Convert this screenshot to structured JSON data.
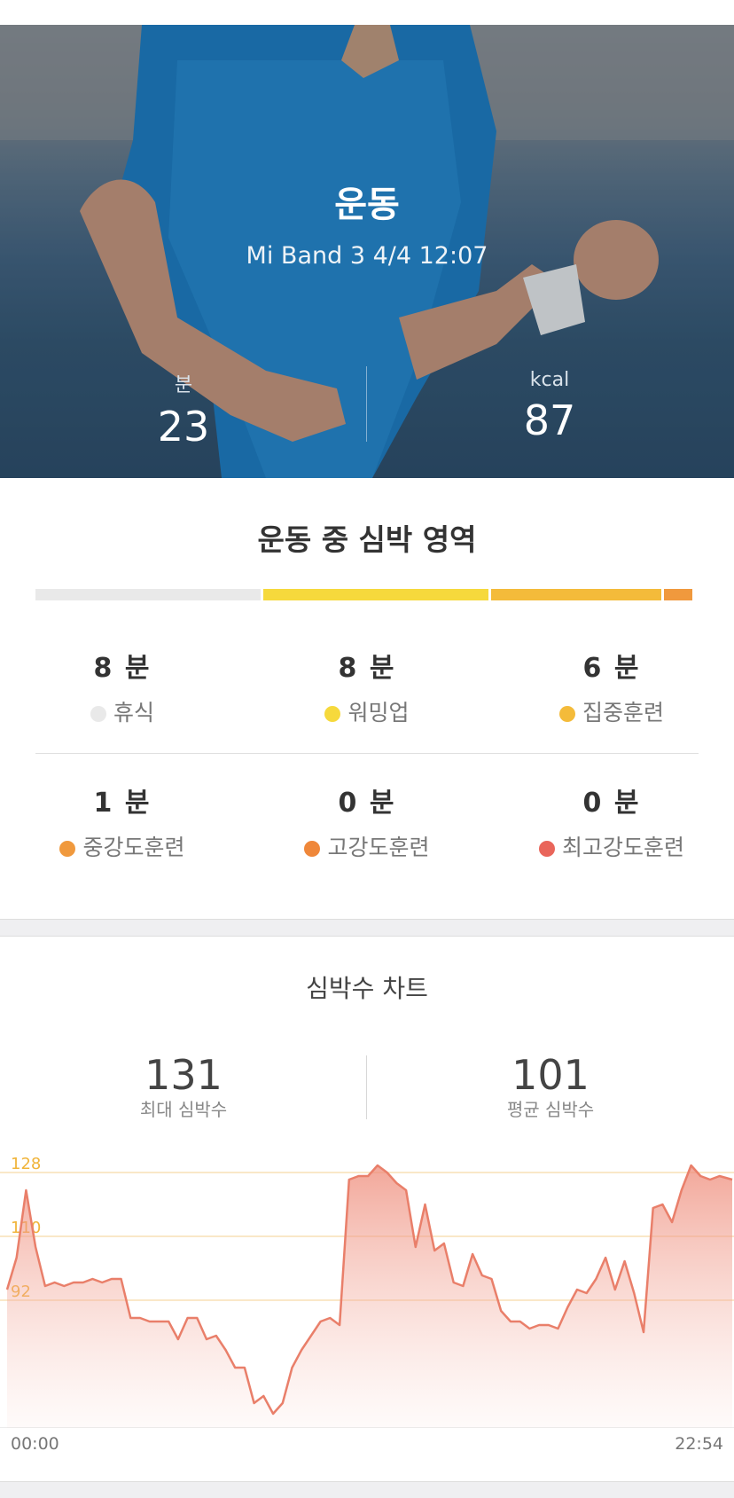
{
  "header": {
    "title": "운동",
    "subtitle": "Mi Band 3 4/4 12:07",
    "duration": {
      "unit": "분",
      "value": "23"
    },
    "calories": {
      "unit": "kcal",
      "value": "87"
    }
  },
  "zones": {
    "title": "운동 중 심박 영역",
    "items": [
      {
        "value": "8 분",
        "label": "휴식",
        "color": "#e9e9e9"
      },
      {
        "value": "8 분",
        "label": "워밍업",
        "color": "#f6d93c"
      },
      {
        "value": "6 분",
        "label": "집중훈련",
        "color": "#f4bb3a"
      },
      {
        "value": "1 분",
        "label": "중강도훈련",
        "color": "#f0993d"
      },
      {
        "value": "0 분",
        "label": "고강도훈련",
        "color": "#ef873a"
      },
      {
        "value": "0 분",
        "label": "최고강도훈련",
        "color": "#e9655a"
      }
    ]
  },
  "heart_rate": {
    "title": "심박수 차트",
    "max": {
      "value": "131",
      "label": "최대 심박수"
    },
    "avg": {
      "value": "101",
      "label": "평균 심박수"
    },
    "time_start": "00:00",
    "time_end": "22:54"
  },
  "chart_data": {
    "type": "area",
    "ylabels": [
      "128",
      "110",
      "92"
    ],
    "gridlines": [
      128,
      110,
      92
    ],
    "ylim": [
      56,
      136
    ],
    "x": [
      0,
      0.3,
      0.6,
      0.9,
      1.2,
      1.5,
      1.8,
      2.1,
      2.4,
      2.7,
      3.0,
      3.3,
      3.6,
      3.9,
      4.2,
      4.5,
      4.8,
      5.1,
      5.4,
      5.7,
      6.0,
      6.3,
      6.6,
      6.9,
      7.2,
      7.5,
      7.8,
      8.1,
      8.4,
      8.7,
      9.0,
      9.3,
      9.6,
      9.9,
      10.2,
      10.5,
      10.8,
      11.1,
      11.4,
      11.7,
      12.0,
      12.3,
      12.6,
      12.9,
      13.2,
      13.5,
      13.8,
      14.1,
      14.4,
      14.7,
      15.0,
      15.3,
      15.6,
      15.9,
      16.2,
      16.5,
      16.8,
      17.1,
      17.4,
      17.7,
      18.0,
      18.3,
      18.6,
      18.9,
      19.2,
      19.5,
      19.8,
      20.1,
      20.4,
      20.7,
      21.0,
      21.3,
      21.6,
      21.9,
      22.2,
      22.5,
      22.9
    ],
    "values": [
      95,
      104,
      123,
      107,
      96,
      97,
      96,
      97,
      97,
      98,
      97,
      98,
      98,
      87,
      87,
      86,
      86,
      86,
      81,
      87,
      87,
      81,
      82,
      78,
      73,
      73,
      63,
      65,
      60,
      63,
      73,
      78,
      82,
      86,
      87,
      85,
      126,
      127,
      127,
      130,
      128,
      125,
      123,
      107,
      119,
      106,
      108,
      97,
      96,
      105,
      99,
      98,
      89,
      86,
      86,
      84,
      85,
      85,
      84,
      90,
      95,
      94,
      98,
      104,
      95,
      103,
      94,
      83,
      118,
      119,
      114,
      123,
      130,
      127,
      126,
      127,
      126
    ],
    "xlabel": "",
    "ylabel": ""
  }
}
